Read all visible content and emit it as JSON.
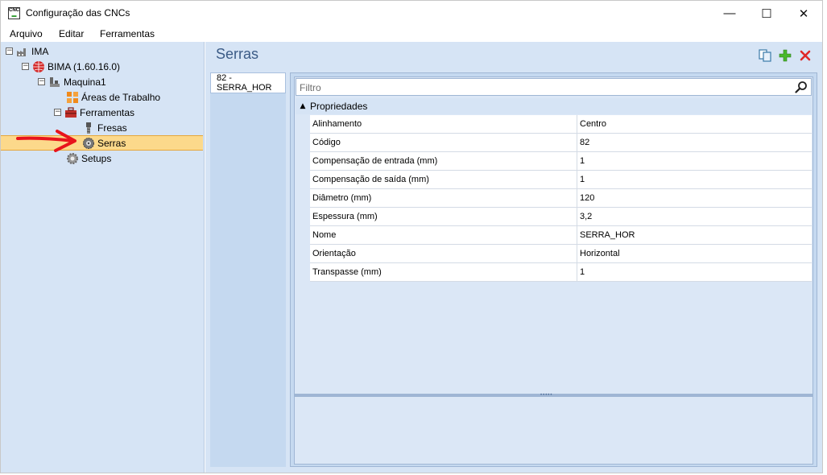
{
  "window": {
    "title": "Configuração das CNCs",
    "app_icon_text": "CNC",
    "minimize": "—",
    "maximize": "☐",
    "close": "✕"
  },
  "menu": [
    "Arquivo",
    "Editar",
    "Ferramentas"
  ],
  "tree": {
    "root": "IMA",
    "bima": "BIMA (1.60.16.0)",
    "machine": "Maquina1",
    "work_areas": "Áreas de Trabalho",
    "tools": "Ferramentas",
    "mills": "Fresas",
    "saws": "Serras",
    "setups": "Setups",
    "toggle_expanded": "−"
  },
  "annotation": {
    "arrow_color": "#e8141c"
  },
  "main": {
    "title": "Serras",
    "list_items": [
      "82 - SERRA_HOR"
    ],
    "filter_placeholder": "Filtro",
    "properties_header": "Propriedades",
    "properties": [
      {
        "key": "Alinhamento",
        "value": "Centro"
      },
      {
        "key": "Código",
        "value": "82"
      },
      {
        "key": "Compensação de entrada (mm)",
        "value": "1"
      },
      {
        "key": "Compensação de saída (mm)",
        "value": "1"
      },
      {
        "key": "Diâmetro (mm)",
        "value": "120"
      },
      {
        "key": "Espessura (mm)",
        "value": "3,2"
      },
      {
        "key": "Nome",
        "value": "SERRA_HOR"
      },
      {
        "key": "Orientação",
        "value": "Horizontal"
      },
      {
        "key": "Transpasse (mm)",
        "value": "1"
      }
    ]
  },
  "colors": {
    "panel_bg": "#d6e4f5",
    "selection": "#fcd98b",
    "title_blue": "#3b5b86"
  }
}
